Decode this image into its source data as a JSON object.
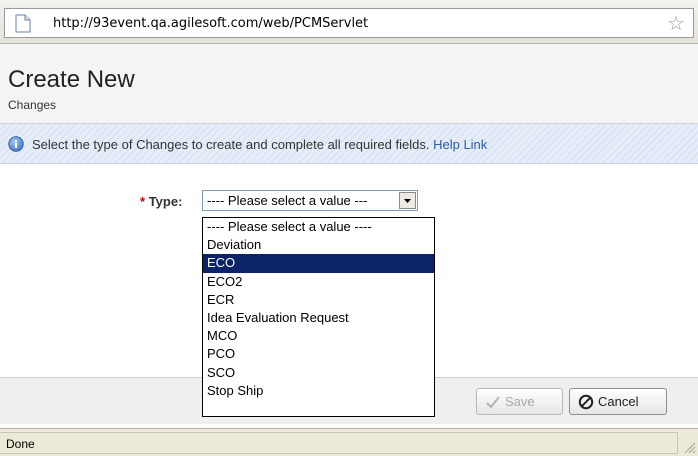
{
  "browser": {
    "url": "http://93event.qa.agilesoft.com/web/PCMServlet",
    "page_icon": "page-icon",
    "bookmark_icon": "star-icon"
  },
  "header": {
    "title": "Create New",
    "subtitle": "Changes"
  },
  "info": {
    "icon": "info-icon",
    "text": "Select the type of Changes to create and complete all required fields.",
    "help_link": "Help Link"
  },
  "form": {
    "required_marker": "*",
    "type_label": "Type:",
    "type_value": "---- Please select a value ---",
    "options": [
      "---- Please select a value ----",
      "Deviation",
      "ECO",
      "ECO2",
      "ECR",
      "Idea Evaluation Request",
      "MCO",
      "PCO",
      "SCO",
      "Stop Ship"
    ],
    "highlighted_option": "ECO"
  },
  "footer": {
    "save_label": "Save",
    "cancel_label": "Cancel"
  },
  "status": {
    "text": "Done"
  },
  "colors": {
    "highlight": "#0a246a",
    "link": "#2a5db0",
    "required": "#cc0000"
  }
}
